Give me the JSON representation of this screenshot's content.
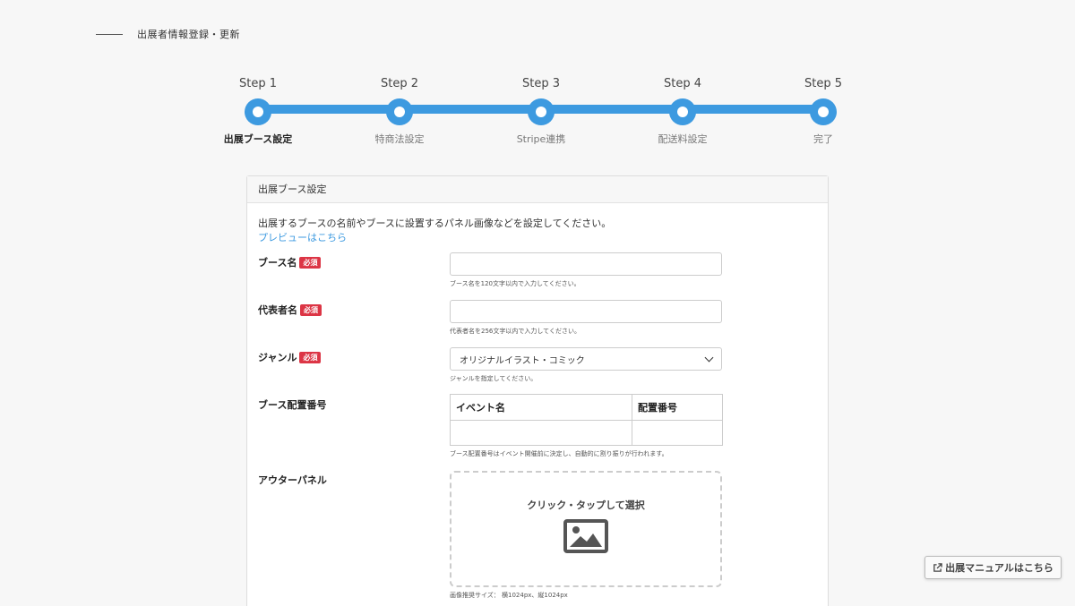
{
  "header": {
    "title": "出展者情報登録・更新"
  },
  "stepper": {
    "steps": [
      {
        "step": "Step 1",
        "name": "出展ブース設定"
      },
      {
        "step": "Step 2",
        "name": "特商法設定"
      },
      {
        "step": "Step 3",
        "name": "Stripe連携"
      },
      {
        "step": "Step 4",
        "name": "配送料設定"
      },
      {
        "step": "Step 5",
        "name": "完了"
      }
    ],
    "active_index": 0,
    "accent_color": "#3d9ae0"
  },
  "card": {
    "title": "出展ブース設定",
    "intro": "出展するブースの名前やブースに設置するパネル画像などを設定してください。",
    "preview_link": "プレビューはこちら",
    "required_badge": "必須",
    "fields": {
      "booth_name": {
        "label": "ブース名",
        "value": "",
        "hint": "ブース名を120文字以内で入力してください。"
      },
      "representative": {
        "label": "代表者名",
        "value": "",
        "hint": "代表者名を256文字以内で入力してください。"
      },
      "genre": {
        "label": "ジャンル",
        "selected": "オリジナルイラスト・コミック",
        "hint": "ジャンルを指定してください。"
      },
      "booth_number": {
        "label": "ブース配置番号",
        "columns": [
          "イベント名",
          "配置番号"
        ],
        "hint": "ブース配置番号はイベント開催前に決定し、自動的に割り振りが行われます。"
      },
      "outer_panel": {
        "label": "アウターパネル",
        "dropzone_text": "クリック・タップして選択",
        "hint": "画像推奨サイズ： 横1024px、縦1024px"
      }
    }
  },
  "manual_button": {
    "label": "出展マニュアルはこちら"
  }
}
